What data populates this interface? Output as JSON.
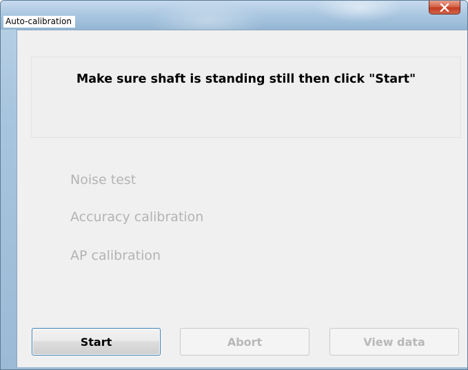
{
  "window": {
    "title": "Auto-calibration"
  },
  "panel": {
    "instruction": "Make sure shaft is standing still then click \"Start\""
  },
  "steps": [
    {
      "label": "Noise test",
      "enabled": false
    },
    {
      "label": "Accuracy calibration",
      "enabled": false
    },
    {
      "label": "AP calibration",
      "enabled": false
    }
  ],
  "buttons": {
    "start": {
      "label": "Start",
      "enabled": true,
      "focused": true
    },
    "abort": {
      "label": "Abort",
      "enabled": false
    },
    "view_data": {
      "label": "View data",
      "enabled": false
    }
  },
  "icons": {
    "close": "close-icon"
  },
  "colors": {
    "focus_border": "#3c7fb1",
    "disabled_text": "#b3b3b3",
    "close_button": "#c23b1f"
  }
}
